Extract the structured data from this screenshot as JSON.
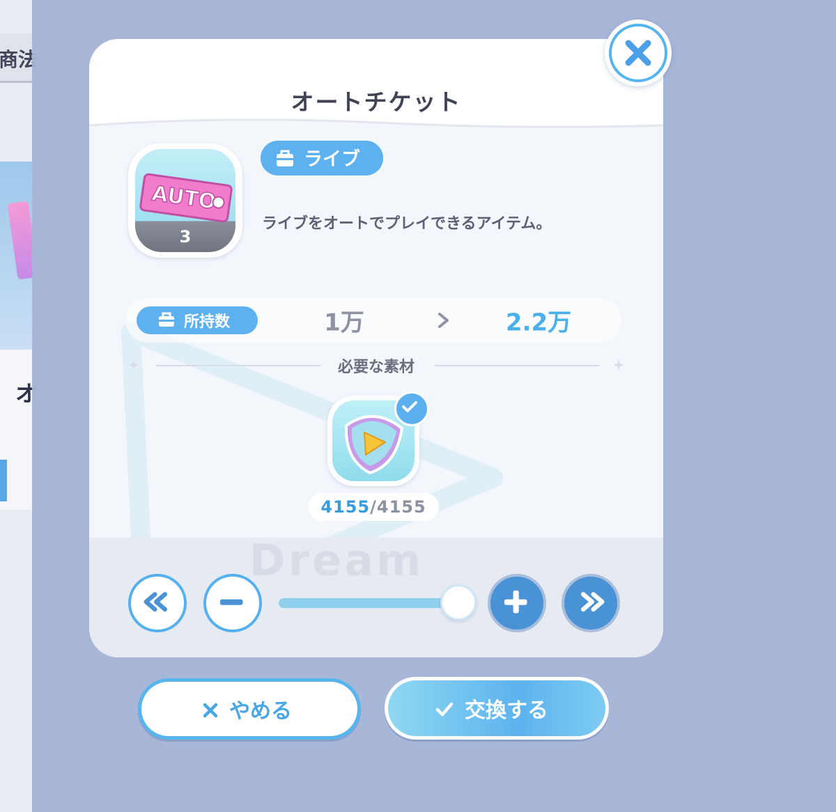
{
  "background": {
    "left_tab_text": "商法",
    "left_card_char": "オ"
  },
  "modal": {
    "title": "オートチケット",
    "close_icon": "close-icon",
    "item": {
      "image_text": "AUTO",
      "count": "3",
      "category_tag": "ライブ",
      "description": "ライブをオートでプレイできるアイテム。"
    },
    "owned": {
      "label": "所持数",
      "from": "1万",
      "to": "2.2万"
    },
    "materials": {
      "label": "必要な素材",
      "have": "4155",
      "separator": "/",
      "need": "4155"
    },
    "slider": {
      "fraction": 1.0
    },
    "controls": {
      "min_icon": "double-chevron-left-icon",
      "minus_icon": "minus-icon",
      "plus_icon": "plus-icon",
      "max_icon": "double-chevron-right-icon"
    },
    "footer_watermark": "Dream"
  },
  "actions": {
    "cancel_label": "やめる",
    "exchange_label": "交換する"
  },
  "colors": {
    "accent": "#56b4ee",
    "accent_dark": "#4a92d6",
    "overlay": "#a9b6d6",
    "text_dark": "#404354"
  }
}
